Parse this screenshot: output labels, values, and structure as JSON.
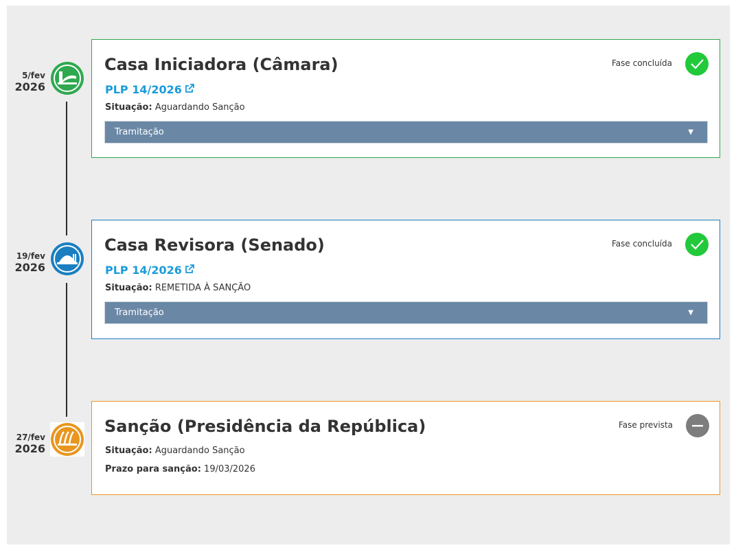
{
  "phases": [
    {
      "date_day_month": "5/fev",
      "date_year": "2026",
      "title": "Casa Iniciadora (Câmara)",
      "link_text": "PLP 14/2026",
      "situacao_label": "Situação:",
      "situacao_value": "Aguardando Sanção",
      "tramitacao_label": "Tramitação",
      "status_text": "Fase concluída",
      "status": "done",
      "color": "#2fa84f",
      "icon": "camara-icon"
    },
    {
      "date_day_month": "19/fev",
      "date_year": "2026",
      "title": "Casa Revisora (Senado)",
      "link_text": "PLP 14/2026",
      "situacao_label": "Situação:",
      "situacao_value": "REMETIDA À SANÇÃO",
      "tramitacao_label": "Tramitação",
      "status_text": "Fase concluída",
      "status": "done",
      "color": "#1a7fc1",
      "icon": "senado-icon"
    },
    {
      "date_day_month": "27/fev",
      "date_year": "2026",
      "title": "Sanção (Presidência da República)",
      "situacao_label": "Situação:",
      "situacao_value": "Aguardando Sanção",
      "prazo_label": "Prazo para sanção:",
      "prazo_value": "19/03/2026",
      "status_text": "Fase prevista",
      "status": "pending",
      "color": "#e8961e",
      "icon": "presidencia-icon"
    }
  ],
  "colors": {
    "done_check": "#22c93a",
    "pending": "#7d7d7d",
    "link": "#1a9bdb",
    "bar": "#6a88a5"
  }
}
